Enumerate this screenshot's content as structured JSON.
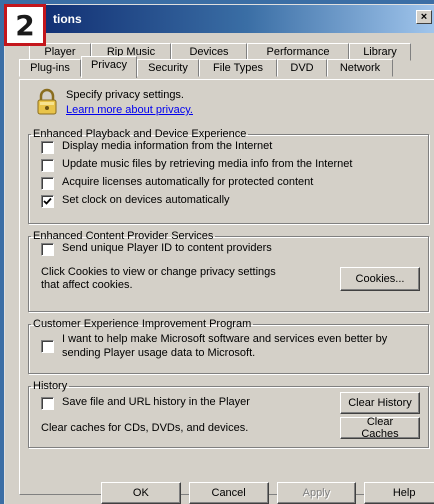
{
  "badge": {
    "number": "2"
  },
  "window": {
    "title": "tions",
    "close_label": "×"
  },
  "tabs": {
    "back_row": [
      "Player",
      "Rip Music",
      "Devices",
      "Performance",
      "Library"
    ],
    "front_row": [
      "Plug-ins",
      "Privacy",
      "Security",
      "File Types",
      "DVD",
      "Network"
    ],
    "active": "Privacy"
  },
  "privacy": {
    "heading": "Specify privacy settings.",
    "link": "Learn more about privacy."
  },
  "enhanced_playback": {
    "legend": "Enhanced Playback and Device Experience",
    "options": [
      {
        "label": "Display media information from the Internet",
        "checked": false
      },
      {
        "label": "Update music files by retrieving media info from the Internet",
        "checked": false
      },
      {
        "label": "Acquire licenses automatically for protected content",
        "checked": false
      },
      {
        "label": "Set clock on devices automatically",
        "checked": true
      }
    ]
  },
  "content_provider": {
    "legend": "Enhanced Content Provider Services",
    "option": {
      "label": "Send unique Player ID to content providers",
      "checked": false
    },
    "cookies_text_1": "Click Cookies to view or change privacy settings",
    "cookies_text_2": "that affect cookies.",
    "cookies_button": "Cookies..."
  },
  "ceip": {
    "legend": "Customer Experience Improvement Program",
    "option_line1": "I want to help make Microsoft software and services even better by",
    "option_line2": "sending Player usage data to Microsoft.",
    "checked": false
  },
  "history": {
    "legend": "History",
    "option": {
      "label": "Save file and URL history in the Player",
      "checked": false
    },
    "clear_history_button": "Clear History",
    "caches_text": "Clear caches for CDs, DVDs, and devices.",
    "clear_caches_button": "Clear Caches"
  },
  "footer": {
    "ok": "OK",
    "cancel": "Cancel",
    "apply": "Apply",
    "help": "Help"
  }
}
